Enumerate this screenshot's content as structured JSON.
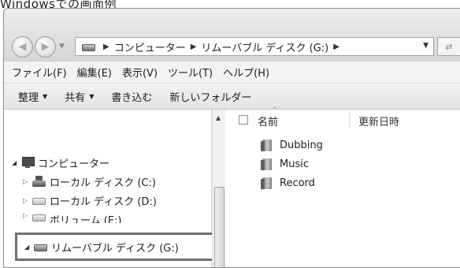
{
  "caption": "Windowsでの画面例",
  "address": {
    "segments": [
      "コンピューター",
      "リムーバブル ディスク (G:)"
    ]
  },
  "menu": [
    "ファイル(F)",
    "編集(E)",
    "表示(V)",
    "ツール(T)",
    "ヘルプ(H)"
  ],
  "toolbar": {
    "organize": "整理",
    "share": "共有",
    "burn": "書き込む",
    "new_folder": "新しいフォルダー"
  },
  "columns": {
    "name": "名前",
    "date": "更新日時"
  },
  "tree": [
    {
      "label": "コンピューター",
      "icon": "computer-icon",
      "expanded": true
    },
    {
      "label": "ローカル ディスク (C:)",
      "icon": "system-drive-icon",
      "expanded": false
    },
    {
      "label": "ローカル ディスク (D:)",
      "icon": "drive-icon",
      "expanded": false
    },
    {
      "label": "ボリューム (E:)",
      "icon": "drive-icon",
      "expanded": false
    },
    {
      "label": "リムーバブル ディスク (G:)",
      "icon": "removable-drive-icon",
      "expanded": true,
      "selected": true
    }
  ],
  "files": [
    {
      "name": "Dubbing",
      "icon": "folder-icon"
    },
    {
      "name": "Music",
      "icon": "folder-icon"
    },
    {
      "name": "Record",
      "icon": "folder-icon"
    }
  ]
}
